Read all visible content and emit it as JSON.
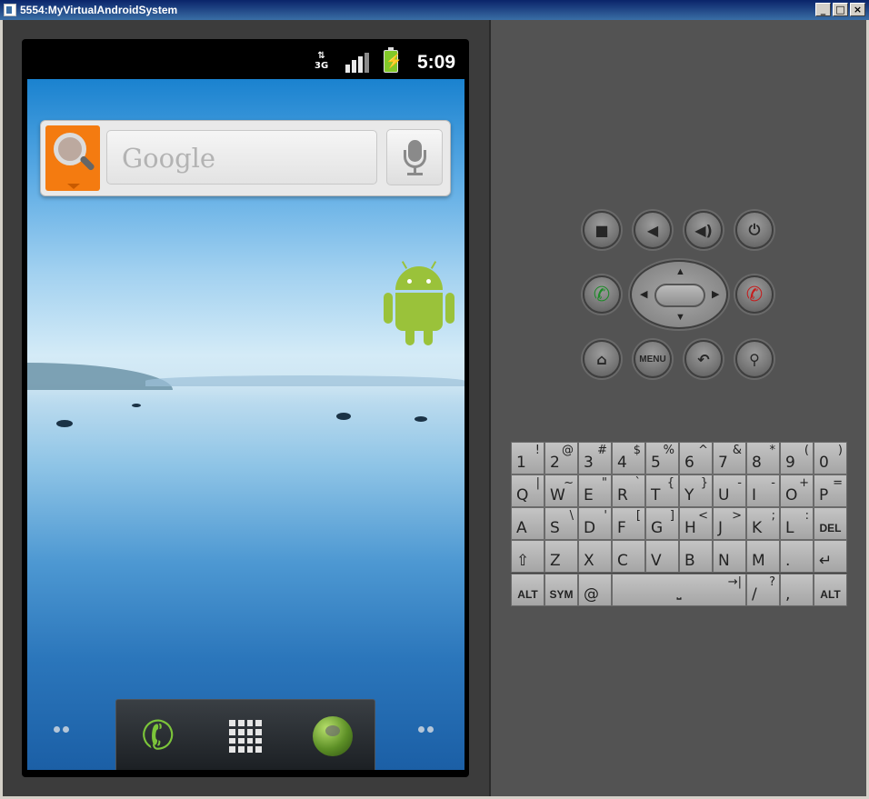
{
  "window": {
    "title": "5554:MyVirtualAndroidSystem",
    "minimize": "_",
    "maximize": "□",
    "close": "×"
  },
  "statusbar": {
    "network": "3G",
    "time": "5:09",
    "battery_icon": "⚡"
  },
  "search_widget": {
    "placeholder": "Google"
  },
  "icons": {
    "phone": "✆",
    "camera": "■",
    "vol_down": "◀",
    "vol_up": "◀)",
    "power": "⏻",
    "call": "✆",
    "end_call": "✆",
    "home": "⌂",
    "back": "↶",
    "search": "⚲"
  },
  "controls": {
    "menu_label": "MENU",
    "dpad": {
      "up": "▲",
      "down": "▼",
      "left": "◀",
      "right": "▶"
    }
  },
  "keyboard": {
    "rows": [
      [
        [
          "1",
          "!"
        ],
        [
          "2",
          "@"
        ],
        [
          "3",
          "#"
        ],
        [
          "4",
          "$"
        ],
        [
          "5",
          "%"
        ],
        [
          "6",
          "^"
        ],
        [
          "7",
          "&"
        ],
        [
          "8",
          "*"
        ],
        [
          "9",
          "("
        ],
        [
          "0",
          ")"
        ]
      ],
      [
        [
          "Q",
          "|"
        ],
        [
          "W",
          "~"
        ],
        [
          "E",
          "\""
        ],
        [
          "R",
          "`"
        ],
        [
          "T",
          "{"
        ],
        [
          "Y",
          "}"
        ],
        [
          "U",
          "-"
        ],
        [
          "I",
          "-"
        ],
        [
          "O",
          "+"
        ],
        [
          "P",
          "="
        ]
      ],
      [
        [
          "A",
          ""
        ],
        [
          "S",
          "\\"
        ],
        [
          "D",
          "'"
        ],
        [
          "F",
          "["
        ],
        [
          "G",
          "]"
        ],
        [
          "H",
          "<"
        ],
        [
          "J",
          ">"
        ],
        [
          "K",
          ";"
        ],
        [
          "L",
          ":"
        ],
        [
          "DEL",
          ""
        ]
      ],
      [
        [
          "⇧",
          ""
        ],
        [
          "Z",
          ""
        ],
        [
          "X",
          ""
        ],
        [
          "C",
          ""
        ],
        [
          "V",
          ""
        ],
        [
          "B",
          ""
        ],
        [
          "N",
          ""
        ],
        [
          "M",
          ""
        ],
        [
          ".",
          ""
        ],
        [
          "↵",
          ""
        ]
      ]
    ],
    "bottom_row": {
      "alt_left": "ALT",
      "sym": "SYM",
      "at": "@",
      "space": "⎵",
      "tab_glyph": "→|",
      "slash": "/",
      "question": "?",
      "comma": ",",
      "alt_right": "ALT"
    }
  },
  "colors": {
    "search_orange": "#f47b10",
    "android_green": "#9ac23a",
    "call_green": "#1f8a2a",
    "end_red": "#c41e1e"
  }
}
